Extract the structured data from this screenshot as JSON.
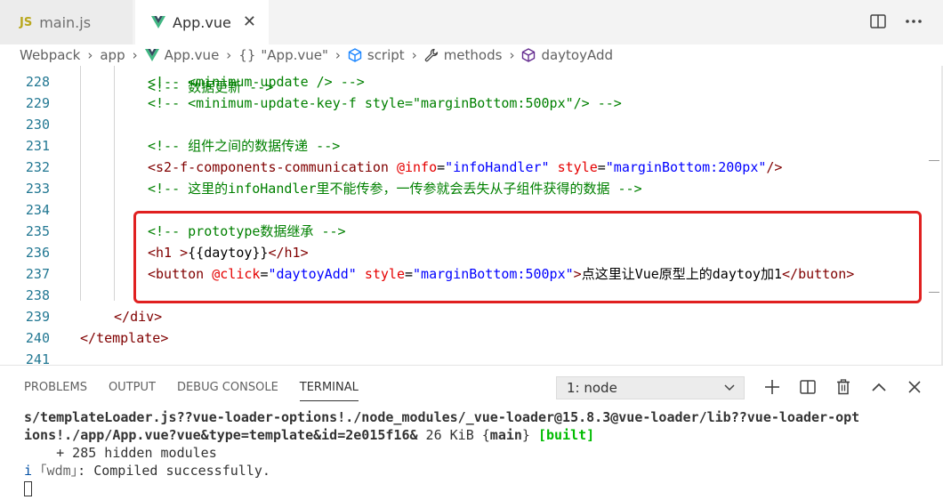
{
  "tabs": [
    {
      "badge": "JS",
      "label": "main.js",
      "active": false
    },
    {
      "label": "App.vue",
      "active": true,
      "close": "✕"
    }
  ],
  "breadcrumb": {
    "items": [
      "Webpack",
      "app",
      "App.vue",
      "\"App.vue\"",
      "script",
      "methods",
      "daytoyAdd"
    ],
    "obj_glyph": "{}",
    "sep": "›"
  },
  "editor": {
    "lines": [
      {
        "n": "228",
        "tokens": [
          {
            "t": "<!-- <minimum-update /> -->",
            "c": "comment"
          }
        ]
      },
      {
        "n": "229",
        "tokens": [
          {
            "t": "<!-- <minimum-update-key-f style=\"marginBottom:500px\"/> -->",
            "c": "comment"
          }
        ]
      },
      {
        "n": "230",
        "tokens": []
      },
      {
        "n": "231",
        "tokens": [
          {
            "t": "<!-- 组件之间的数据传递 -->",
            "c": "comment"
          }
        ]
      },
      {
        "n": "232",
        "tokens": [
          {
            "t": "<",
            "c": "punct"
          },
          {
            "t": "s2-f-components-communication",
            "c": "tag"
          },
          {
            "t": " ",
            "c": "text"
          },
          {
            "t": "@info",
            "c": "attr"
          },
          {
            "t": "=",
            "c": "eq"
          },
          {
            "t": "\"infoHandler\"",
            "c": "str"
          },
          {
            "t": " ",
            "c": "text"
          },
          {
            "t": "style",
            "c": "attr"
          },
          {
            "t": "=",
            "c": "eq"
          },
          {
            "t": "\"marginBottom:200px\"",
            "c": "str"
          },
          {
            "t": "/>",
            "c": "punct"
          }
        ]
      },
      {
        "n": "233",
        "tokens": [
          {
            "t": "<!-- 这里的infoHandler里不能传参，一传参就会丢失从子组件获得的数据 -->",
            "c": "comment"
          }
        ]
      },
      {
        "n": "234",
        "tokens": []
      },
      {
        "n": "235",
        "tokens": [
          {
            "t": "<!-- prototype数据继承 -->",
            "c": "comment"
          }
        ]
      },
      {
        "n": "236",
        "tokens": [
          {
            "t": "<",
            "c": "punct"
          },
          {
            "t": "h1",
            "c": "tag"
          },
          {
            "t": " >",
            "c": "punct"
          },
          {
            "t": "{{daytoy}}",
            "c": "expr"
          },
          {
            "t": "</",
            "c": "punct"
          },
          {
            "t": "h1",
            "c": "tag"
          },
          {
            "t": ">",
            "c": "punct"
          }
        ]
      },
      {
        "n": "237",
        "tokens": [
          {
            "t": "<",
            "c": "punct"
          },
          {
            "t": "button",
            "c": "tag"
          },
          {
            "t": " ",
            "c": "text"
          },
          {
            "t": "@click",
            "c": "attr"
          },
          {
            "t": "=",
            "c": "eq"
          },
          {
            "t": "\"daytoyAdd\"",
            "c": "str"
          },
          {
            "t": " ",
            "c": "text"
          },
          {
            "t": "style",
            "c": "attr"
          },
          {
            "t": "=",
            "c": "eq"
          },
          {
            "t": "\"marginBottom:500px\"",
            "c": "str"
          },
          {
            "t": ">",
            "c": "punct"
          },
          {
            "t": "点这里让Vue原型上的daytoy加1",
            "c": "text"
          },
          {
            "t": "</",
            "c": "punct"
          },
          {
            "t": "button",
            "c": "tag"
          },
          {
            "t": ">",
            "c": "punct"
          }
        ]
      },
      {
        "n": "238",
        "tokens": []
      },
      {
        "n": "239",
        "tokens": [
          {
            "t": "</",
            "c": "punct"
          },
          {
            "t": "div",
            "c": "tag"
          },
          {
            "t": ">",
            "c": "punct"
          }
        ]
      },
      {
        "n": "240",
        "tokens": [
          {
            "t": "</",
            "c": "punct"
          },
          {
            "t": "template",
            "c": "tag"
          },
          {
            "t": ">",
            "c": "punct"
          }
        ]
      },
      {
        "n": "241",
        "tokens": []
      }
    ],
    "partial_top_line": "<!-- 数据更新 -->"
  },
  "panel": {
    "tabs": [
      "PROBLEMS",
      "OUTPUT",
      "DEBUG CONSOLE",
      "TERMINAL"
    ],
    "active_tab": "TERMINAL",
    "terminal_select": "1: node",
    "terminal_lines": [
      {
        "segments": [
          {
            "t": "s/templateLoader.js??vue-loader-options!./node_modules/_vue-loader@15.8.3@vue-loader/lib??vue-loader-opt",
            "c": "bold"
          }
        ]
      },
      {
        "segments": [
          {
            "t": "ions!./app/App.vue?vue&type=template&id=2e015f16&",
            "c": "bold"
          },
          {
            "t": " 26 KiB ",
            "c": "plain"
          },
          {
            "t": "{",
            "c": "plain"
          },
          {
            "t": "main",
            "c": "bold"
          },
          {
            "t": "}",
            "c": "plain"
          },
          {
            "t": " [built]",
            "c": "green"
          }
        ]
      },
      {
        "segments": [
          {
            "t": "    + 285 hidden modules",
            "c": "plain"
          }
        ]
      },
      {
        "segments": [
          {
            "t": "i",
            "c": "blue"
          },
          {
            "t": " ｢wdm｣",
            "c": "gray"
          },
          {
            "t": ": Compiled successfully.",
            "c": "plain"
          }
        ]
      }
    ]
  },
  "colors": {
    "comment": "#008000",
    "tag": "#800000",
    "attr": "#e50000",
    "string": "#0000ff",
    "line_number": "#237893",
    "highlight_box": "#e02020",
    "built_green": "#00bc00"
  }
}
